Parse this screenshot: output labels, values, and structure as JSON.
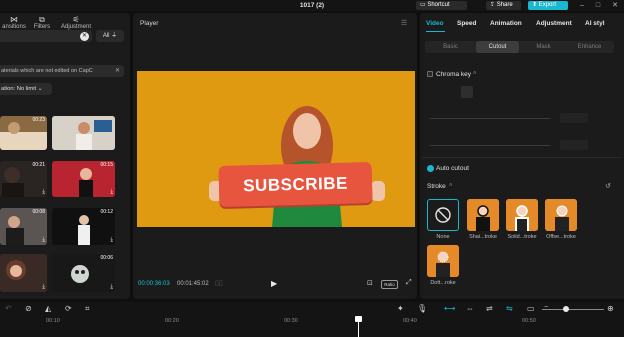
{
  "window": {
    "title": "1017 (2)",
    "shortcut_label": "Shortcut",
    "share_label": "Share",
    "export_label": "Export"
  },
  "left_panel": {
    "tabs": [
      {
        "label": "ansitions",
        "icon": "transitions-icon"
      },
      {
        "label": "Filters",
        "icon": "filters-icon"
      },
      {
        "label": "Adjustment",
        "icon": "adjustment-icon"
      }
    ],
    "filter_label": "All",
    "notice_text": "aterials which are not edited on CapC",
    "duration_label": "ation: No limit",
    "thumbnails": [
      {
        "duration": "00:23",
        "bg": "#8a6a43"
      },
      {
        "duration": "",
        "bg": "#c9c2bb"
      },
      {
        "duration": "00:21",
        "bg": "#2a2422"
      },
      {
        "duration": "00:15",
        "bg": "#b8242f"
      },
      {
        "duration": "00:08",
        "bg": "#4a4644"
      },
      {
        "duration": "00:12",
        "bg": "#101010"
      },
      {
        "duration": "",
        "bg": "#3a2a26"
      },
      {
        "duration": "00:06",
        "bg": "#181818"
      }
    ]
  },
  "player": {
    "title": "Player",
    "sign_text": "SUBSCRIBE",
    "current_time": "00:00:36:03",
    "total_time": "00:01:45:02",
    "ratio_label": "Ratio"
  },
  "right_panel": {
    "tabs": [
      "Video",
      "Speed",
      "Animation",
      "Adjustment",
      "AI styl"
    ],
    "subtabs": [
      "Basic",
      "Cutout",
      "Mask",
      "Enhance"
    ],
    "chroma_key_label": "Chroma key",
    "auto_cutout_label": "Auto cutout",
    "stroke_label": "Stroke",
    "presets": [
      {
        "label": "None"
      },
      {
        "label": "Shai...troke"
      },
      {
        "label": "Solid...troke"
      },
      {
        "label": "Offse...troke"
      },
      {
        "label": "Dott...roke"
      }
    ]
  },
  "timeline": {
    "ticks": [
      "00:10",
      "00:20",
      "00:30",
      "00:40",
      "00:50"
    ]
  },
  "colors": {
    "accent": "#19b8cf",
    "video_bg": "#e09a12",
    "sign": "#e8553f"
  }
}
